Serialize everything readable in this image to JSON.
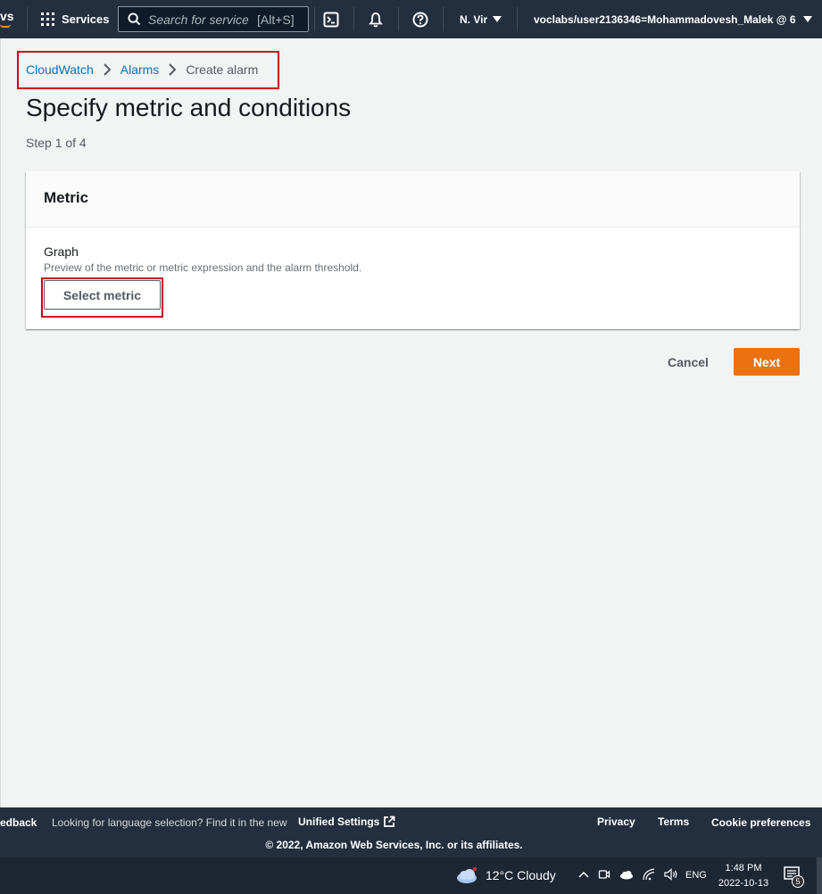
{
  "nav": {
    "logo_text": "vs",
    "services_label": "Services",
    "search_placeholder": "Search for services",
    "search_shortcut": "[Alt+S]",
    "region_label": "N. Vir",
    "account_label": "voclabs/user2136346=Mohammadovesh_Malek @ 6",
    "icons": [
      "cloudshell-icon",
      "bell-icon",
      "help-icon"
    ]
  },
  "breadcrumb": {
    "items": [
      {
        "label": "CloudWatch"
      },
      {
        "label": "Alarms"
      },
      {
        "label": "Create alarm"
      }
    ]
  },
  "page": {
    "title": "Specify metric and conditions",
    "step": "Step 1 of 4"
  },
  "metric_panel": {
    "header": "Metric",
    "field_label": "Graph",
    "field_description": "Preview of the metric or metric expression and the alarm threshold.",
    "select_button": "Select metric"
  },
  "actions": {
    "cancel": "Cancel",
    "next": "Next"
  },
  "footer": {
    "feedback": "edback",
    "language_text": "Looking for language selection? Find it in the new",
    "unified_settings": "Unified Settings",
    "privacy": "Privacy",
    "terms": "Terms",
    "cookie": "Cookie preferences",
    "copyright": "© 2022, Amazon Web Services, Inc. or its affiliates."
  },
  "taskbar": {
    "weather": "12°C  Cloudy",
    "language": "ENG",
    "time": "1:48 PM",
    "date": "2022-10-13",
    "notification_count": "5"
  },
  "colors": {
    "nav_bg": "#232f3e",
    "link": "#0073bb",
    "primary": "#ec7211",
    "highlight_box": "#d0021b"
  }
}
